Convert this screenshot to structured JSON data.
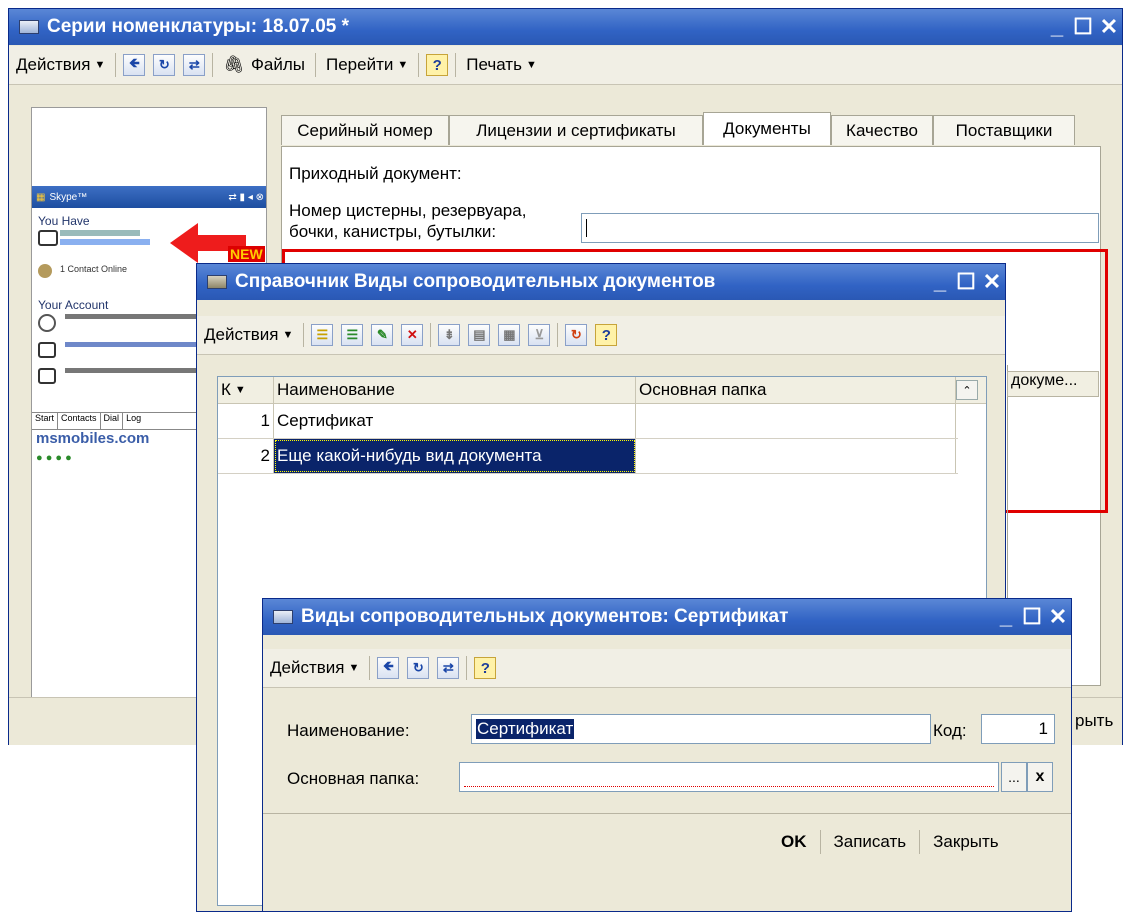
{
  "main_window": {
    "title": "Серии номенклатуры: 18.07.05 *",
    "toolbar": {
      "actions_label": "Действия",
      "files_label": "Файлы",
      "goto_label": "Перейти",
      "help_label": "?",
      "print_label": "Печать"
    },
    "tabs": [
      "Серийный номер",
      "Лицензии и сертификаты",
      "Документы",
      "Качество",
      "Поставщики"
    ],
    "active_tab": "Документы",
    "incoming_doc_label": "Приходный документ:",
    "tank_label_line1": "Номер цистерны, резервуара,",
    "tank_label_line2": "бочки, канистры, бутылки:",
    "partial_header": "докуме...",
    "close_partial": "рыть"
  },
  "phone_preview": {
    "app_name": "Skype™",
    "you_have": "You Have",
    "new_badge": "NEW",
    "contact_online": "1 Contact Online",
    "your_account": "Your Account",
    "tabs": [
      "Start",
      "Contacts",
      "Dial",
      "Log"
    ],
    "watermark": "msmobiles.com"
  },
  "doc_types_window": {
    "title": "Справочник Виды сопроводительных документов",
    "toolbar": {
      "actions_label": "Действия",
      "help_label": "?"
    },
    "columns": [
      "К",
      "Наименование",
      "Основная папка"
    ],
    "rows": [
      {
        "code": "1",
        "name": "Сертификат",
        "folder": ""
      },
      {
        "code": "2",
        "name": "Еще какой-нибудь вид документа",
        "folder": ""
      }
    ]
  },
  "cert_window": {
    "title": "Виды сопроводительных документов: Сертификат",
    "toolbar": {
      "actions_label": "Действия",
      "help_label": "?"
    },
    "name_label": "Наименование:",
    "name_value": "Сертификат",
    "code_label": "Код:",
    "code_value": "1",
    "folder_label": "Основная папка:",
    "folder_value": "",
    "ellipsis": "...",
    "clear": "x",
    "ok_label": "OK",
    "save_label": "Записать",
    "close_label": "Закрыть"
  },
  "colors": {
    "title_blue": "#3163c4",
    "highlight_red": "#e00000",
    "selection_navy": "#0a246a"
  }
}
